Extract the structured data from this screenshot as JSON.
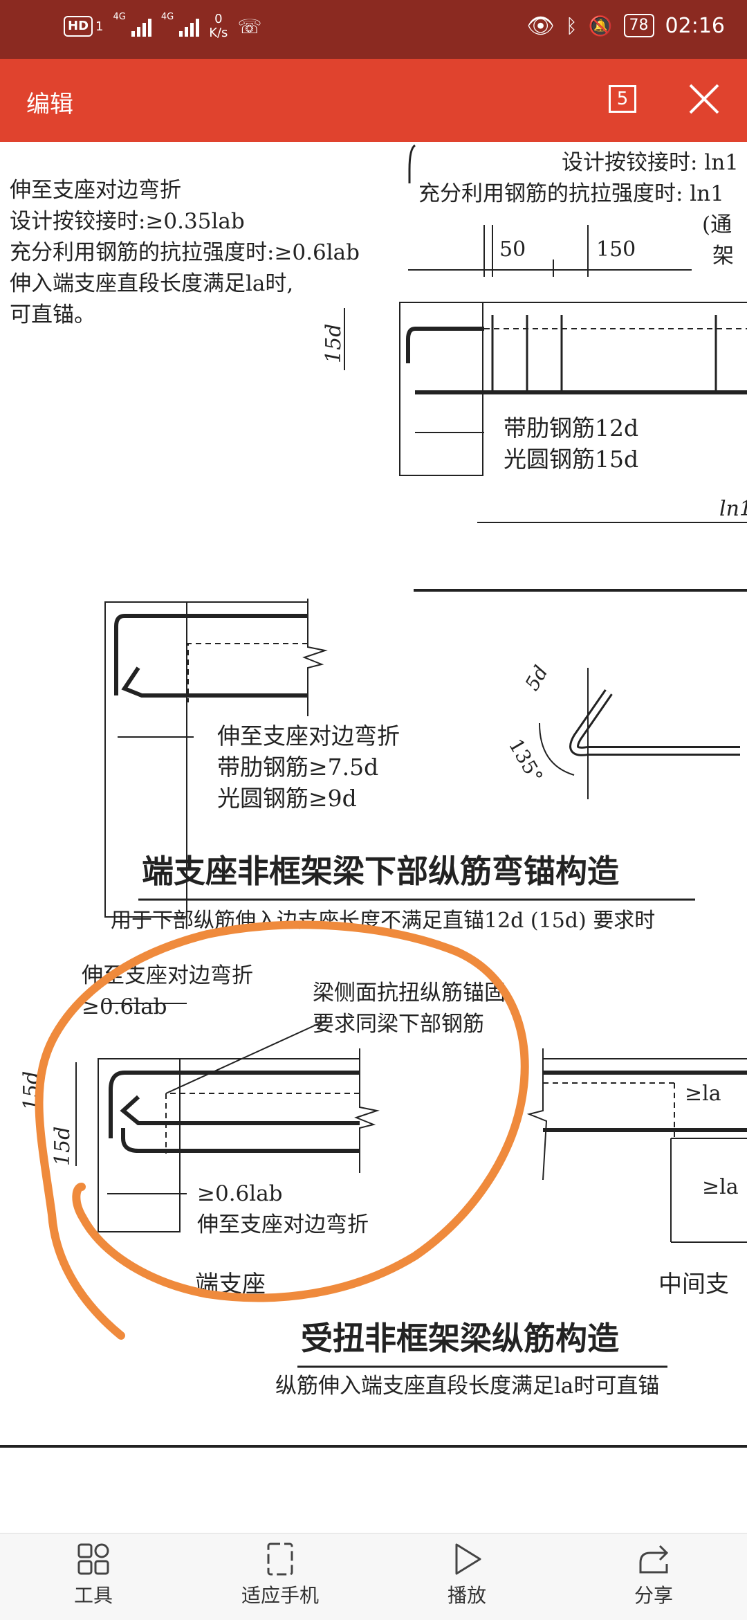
{
  "status_bar": {
    "hd": "HD",
    "sim": "1",
    "net1": "4G",
    "net2": "4G",
    "speed_value": "0",
    "speed_unit": "K/s",
    "battery": "78",
    "time": "02:16"
  },
  "toolbar": {
    "title": "编辑",
    "page_count": "5"
  },
  "document": {
    "top_left_notes": [
      "伸至支座对边弯折",
      "设计按铰接时:≥0.35lab",
      "充分利用钢筋的抗拉强度时:≥0.6lab",
      "伸入端支座直段长度满足la时,",
      "可直锚。"
    ],
    "top_right_notes": [
      "设计按铰接时: ln1",
      "充分利用钢筋的抗拉强度时: ln1",
      "(通",
      "架"
    ],
    "dim_50": "50",
    "dim_150": "150",
    "dim_15d": "15d",
    "ribbed_12d": "带肋钢筋12d",
    "plain_15d": "光圆钢筋15d",
    "ln1": "ln1",
    "mid_notes": [
      "伸至支座对边弯折",
      "带肋钢筋≥7.5d",
      "光圆钢筋≥9d"
    ],
    "hook_5d": "5d",
    "hook_135": "135°",
    "section1_title": "端支座非框架梁下部纵筋弯锚构造",
    "section1_subtitle": "用于下部纵筋伸入边支座长度不满足直锚12d (15d) 要求时",
    "lower_notes_left": [
      "伸至支座对边弯折",
      "≥0.6lab"
    ],
    "lower_notes_right": [
      "梁侧面抗扭纵筋锚固",
      "要求同梁下部钢筋"
    ],
    "lower_dim_15d_a": "15d",
    "lower_dim_15d_b": "15d",
    "lower_bottom_notes": [
      "≥0.6lab",
      "伸至支座对边弯折"
    ],
    "la_top": "≥la",
    "la_bottom": "≥la",
    "end_support": "端支座",
    "middle_support": "中间支",
    "section2_title": "受扭非框架梁纵筋构造",
    "section2_subtitle": "纵筋伸入端支座直段长度满足la时可直锚"
  },
  "bottom_bar": {
    "tools": "工具",
    "fit_phone": "适应手机",
    "play": "播放",
    "share": "分享"
  },
  "colors": {
    "status_bar": "#8b2a21",
    "toolbar": "#e0432e",
    "annotation": "#ef8a3c"
  }
}
